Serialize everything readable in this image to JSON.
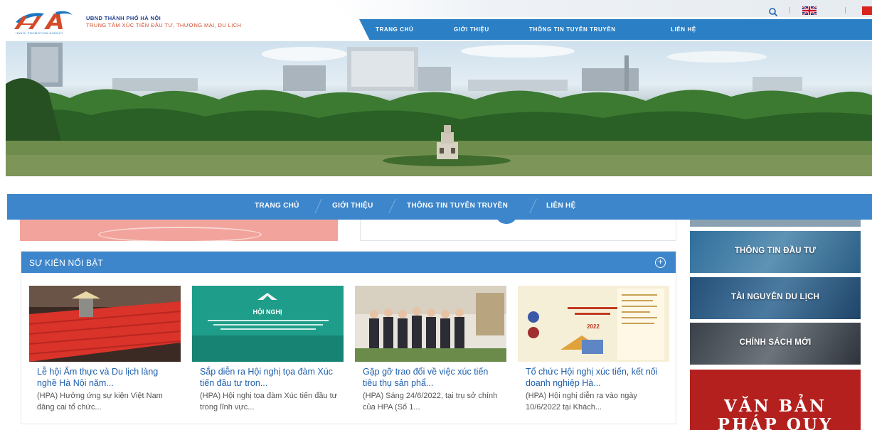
{
  "header": {
    "logo_sub": "HANOI PROMOTION AGENCY",
    "org_line1": "UBND THÀNH PHỐ HÀ NỘI",
    "org_line2": "TRUNG TÂM XÚC TIẾN ĐẦU TƯ, THƯƠNG MẠI, DU LỊCH"
  },
  "nav": [
    {
      "label": "TRANG CHỦ"
    },
    {
      "label": "GIỚI THIỆU"
    },
    {
      "label": "THÔNG TIN TUYÊN TRUYỀN"
    },
    {
      "label": "LIÊN HỆ"
    }
  ],
  "events": {
    "title": "SỰ KIỆN NỔI BẬT",
    "items": [
      {
        "title": "Lễ hội Ẩm thực và Du lịch làng nghề Hà Nội năm...",
        "excerpt": "(HPA) Hưởng ứng sự kiện Việt Nam đăng cai tổ chức..."
      },
      {
        "title": "Sắp diễn ra Hội nghị tọa đàm Xúc tiến đầu tư tron...",
        "excerpt": "(HPA) Hội nghị tọa đàm Xúc tiến đầu tư trong lĩnh vực...",
        "poster_title": "HỘI NGHỊ"
      },
      {
        "title": "Gặp gỡ trao đổi về việc xúc tiến tiêu thụ sản phẩ...",
        "excerpt": "(HPA) Sáng 24/6/2022, tại trụ sở chính của HPA (Số 1..."
      },
      {
        "title": "Tổ chức Hội nghị xúc tiến, kết nối doanh nghiệp Hà...",
        "excerpt": "(HPA) Hội nghị diễn ra vào ngày 10/6/2022 tại Khách...",
        "poster_year": "2022"
      }
    ]
  },
  "sidebar": {
    "tiles": [
      {
        "label": "THÔNG TIN ĐẦU TƯ"
      },
      {
        "label": "TÀI NGUYÊN DU LỊCH"
      },
      {
        "label": "CHÍNH SÁCH MỚI"
      }
    ],
    "legal_line1": "VĂN BẢN",
    "legal_line2": "PHÁP QUY"
  },
  "colors": {
    "primary_blue": "#3e86cb",
    "nav_blue": "#2a7fc5",
    "link_blue": "#1e5fab",
    "brand_red": "#d34b2b",
    "legal_red": "#b3201e"
  },
  "icons": [
    "search-icon",
    "uk-flag-icon",
    "vn-flag-icon",
    "plus-circle-icon"
  ]
}
